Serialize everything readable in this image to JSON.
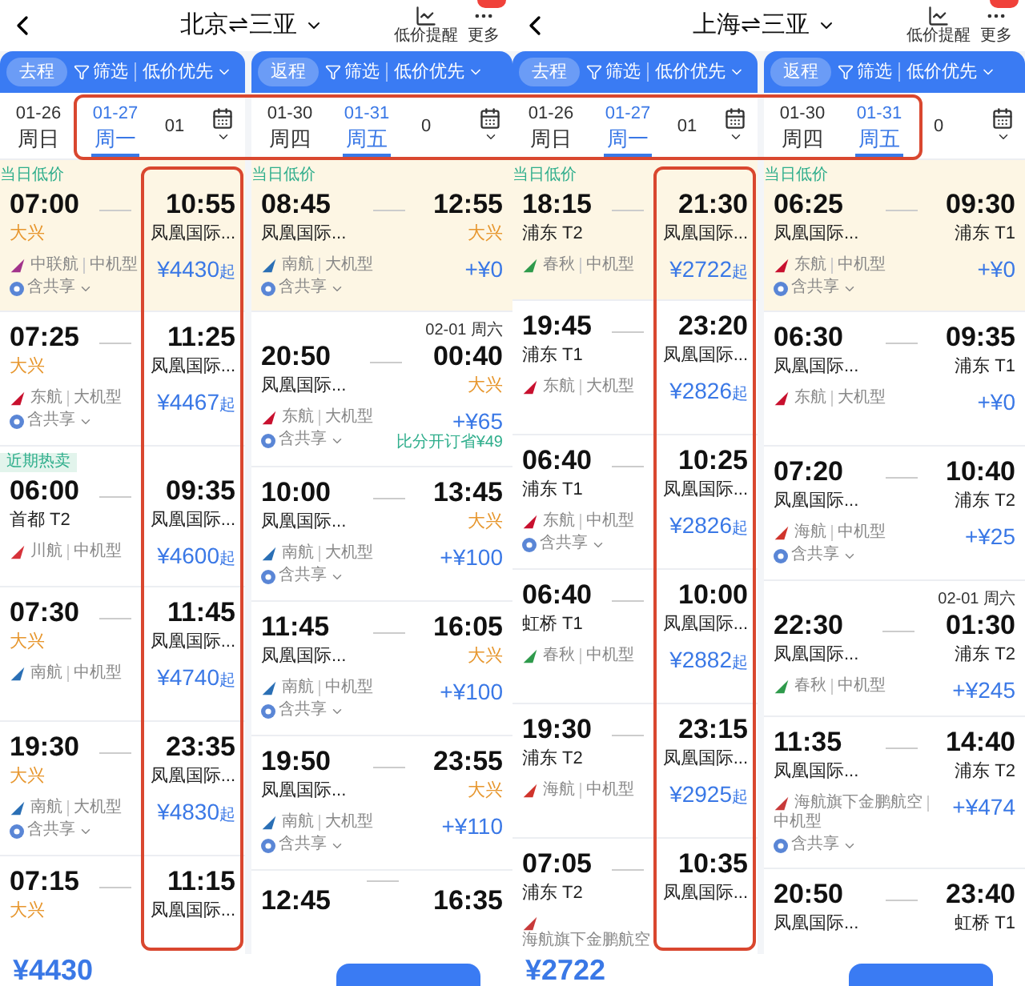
{
  "date_frame": true,
  "screens": [
    {
      "title": "北京⇌三亚",
      "alert_label": "低价提醒",
      "more_label": "更多",
      "total_price": "¥4430",
      "panels": [
        {
          "trip": "去程",
          "filter": "筛选",
          "sort": "低价优先",
          "price_frame": true,
          "dates": [
            {
              "date": "01-26",
              "weekday": "周日",
              "selected": false
            },
            {
              "date": "01-27",
              "weekday": "周一",
              "selected": true
            },
            {
              "date": "01",
              "selected": false
            }
          ],
          "flights": [
            {
              "tag": {
                "text": "当日低价",
                "kind": "plain"
              },
              "highlighted": true,
              "depart": {
                "time": "07:00",
                "airport": "大兴",
                "alert": true
              },
              "arrive": {
                "time": "10:55",
                "airport": "凤凰国际...",
                "alert": false
              },
              "airline": {
                "name": "中联航",
                "color": "#a2338b",
                "aircraft": "中机型"
              },
              "share_label": "含共享",
              "price": "¥4430",
              "price_suffix": "起"
            },
            {
              "highlighted": false,
              "depart": {
                "time": "07:25",
                "airport": "大兴",
                "alert": true
              },
              "arrive": {
                "time": "11:25",
                "airport": "凤凰国际...",
                "alert": false
              },
              "airline": {
                "name": "东航",
                "color": "#c8102e",
                "aircraft": "大机型"
              },
              "share_label": "含共享",
              "price": "¥4467",
              "price_suffix": "起"
            },
            {
              "tag": {
                "text": "近期热卖",
                "kind": "badge"
              },
              "highlighted": false,
              "depart": {
                "time": "06:00",
                "airport": "首都 T2",
                "alert": false
              },
              "arrive": {
                "time": "09:35",
                "airport": "凤凰国际...",
                "alert": false
              },
              "airline": {
                "name": "川航",
                "color": "#d6323a",
                "aircraft": "中机型"
              },
              "price": "¥4600",
              "price_suffix": "起"
            },
            {
              "highlighted": false,
              "depart": {
                "time": "07:30",
                "airport": "大兴",
                "alert": true
              },
              "arrive": {
                "time": "11:45",
                "airport": "凤凰国际...",
                "alert": false
              },
              "airline": {
                "name": "南航",
                "color": "#2a6fb5",
                "aircraft": "中机型"
              },
              "price": "¥4740",
              "price_suffix": "起"
            },
            {
              "highlighted": false,
              "depart": {
                "time": "19:30",
                "airport": "大兴",
                "alert": true
              },
              "arrive": {
                "time": "23:35",
                "airport": "凤凰国际...",
                "alert": false
              },
              "airline": {
                "name": "南航",
                "color": "#2a6fb5",
                "aircraft": "大机型"
              },
              "share_label": "含共享",
              "price": "¥4830",
              "price_suffix": "起"
            },
            {
              "highlighted": false,
              "depart": {
                "time": "07:15",
                "airport": "大兴",
                "alert": true
              },
              "arrive": {
                "time": "11:15",
                "airport": "凤凰国际...",
                "alert": false
              }
            }
          ]
        },
        {
          "trip": "返程",
          "filter": "筛选",
          "sort": "低价优先",
          "dates": [
            {
              "date": "01-30",
              "weekday": "周四",
              "selected": false
            },
            {
              "date": "01-31",
              "weekday": "周五",
              "selected": true
            },
            {
              "date": "0",
              "selected": false
            }
          ],
          "flights": [
            {
              "tag": {
                "text": "当日低价",
                "kind": "plain"
              },
              "highlighted": true,
              "depart": {
                "time": "08:45",
                "airport": "凤凰国际...",
                "alert": false
              },
              "arrive": {
                "time": "12:55",
                "airport": "大兴",
                "alert": true
              },
              "airline": {
                "name": "南航",
                "color": "#2a6fb5",
                "aircraft": "大机型"
              },
              "share_label": "含共享",
              "price": "+¥0"
            },
            {
              "highlighted": false,
              "depart": {
                "time": "20:50",
                "airport": "凤凰国际...",
                "alert": false
              },
              "arrive": {
                "date_note": "02-01 周六",
                "time": "00:40",
                "airport": "大兴",
                "alert": true
              },
              "airline": {
                "name": "东航",
                "color": "#c8102e",
                "aircraft": "大机型"
              },
              "share_label": "含共享",
              "price": "+¥65",
              "saving": "比分开订省¥49"
            },
            {
              "highlighted": false,
              "depart": {
                "time": "10:00",
                "airport": "凤凰国际...",
                "alert": false
              },
              "arrive": {
                "time": "13:45",
                "airport": "大兴",
                "alert": true
              },
              "airline": {
                "name": "南航",
                "color": "#2a6fb5",
                "aircraft": "大机型"
              },
              "share_label": "含共享",
              "price": "+¥100"
            },
            {
              "highlighted": false,
              "depart": {
                "time": "11:45",
                "airport": "凤凰国际...",
                "alert": false
              },
              "arrive": {
                "time": "16:05",
                "airport": "大兴",
                "alert": true
              },
              "airline": {
                "name": "南航",
                "color": "#2a6fb5",
                "aircraft": "中机型"
              },
              "share_label": "含共享",
              "price": "+¥100"
            },
            {
              "highlighted": false,
              "depart": {
                "time": "19:50",
                "airport": "凤凰国际...",
                "alert": false
              },
              "arrive": {
                "time": "23:55",
                "airport": "大兴",
                "alert": true
              },
              "airline": {
                "name": "南航",
                "color": "#2a6fb5",
                "aircraft": "大机型"
              },
              "share_label": "含共享",
              "price": "+¥110"
            },
            {
              "highlighted": false,
              "depart": {
                "time": "12:45"
              },
              "arrive": {
                "time": "16:35"
              }
            }
          ]
        }
      ]
    },
    {
      "title": "上海⇌三亚",
      "alert_label": "低价提醒",
      "more_label": "更多",
      "total_price": "¥2722",
      "panels": [
        {
          "trip": "去程",
          "filter": "筛选",
          "sort": "低价优先",
          "price_frame": true,
          "dates": [
            {
              "date": "01-26",
              "weekday": "周日",
              "selected": false
            },
            {
              "date": "01-27",
              "weekday": "周一",
              "selected": true
            },
            {
              "date": "01",
              "selected": false
            }
          ],
          "flights": [
            {
              "tag": {
                "text": "当日低价",
                "kind": "plain"
              },
              "highlighted": true,
              "depart": {
                "time": "18:15",
                "airport": "浦东 T2",
                "alert": false
              },
              "arrive": {
                "time": "21:30",
                "airport": "凤凰国际...",
                "alert": false
              },
              "airline": {
                "name": "春秋",
                "color": "#2e9a4b",
                "aircraft": "中机型"
              },
              "price": "¥2722",
              "price_suffix": "起"
            },
            {
              "highlighted": false,
              "depart": {
                "time": "19:45",
                "airport": "浦东 T1",
                "alert": false
              },
              "arrive": {
                "time": "23:20",
                "airport": "凤凰国际...",
                "alert": false
              },
              "airline": {
                "name": "东航",
                "color": "#c8102e",
                "aircraft": "大机型"
              },
              "price": "¥2826",
              "price_suffix": "起"
            },
            {
              "highlighted": false,
              "depart": {
                "time": "06:40",
                "airport": "浦东 T1",
                "alert": false
              },
              "arrive": {
                "time": "10:25",
                "airport": "凤凰国际...",
                "alert": false
              },
              "airline": {
                "name": "东航",
                "color": "#c8102e",
                "aircraft": "中机型"
              },
              "share_label": "含共享",
              "price": "¥2826",
              "price_suffix": "起"
            },
            {
              "highlighted": false,
              "depart": {
                "time": "06:40",
                "airport": "虹桥 T1",
                "alert": false
              },
              "arrive": {
                "time": "10:00",
                "airport": "凤凰国际...",
                "alert": false
              },
              "airline": {
                "name": "春秋",
                "color": "#2e9a4b",
                "aircraft": "中机型"
              },
              "price": "¥2882",
              "price_suffix": "起"
            },
            {
              "highlighted": false,
              "depart": {
                "time": "19:30",
                "airport": "浦东 T2",
                "alert": false
              },
              "arrive": {
                "time": "23:15",
                "airport": "凤凰国际...",
                "alert": false
              },
              "airline": {
                "name": "海航",
                "color": "#d0342c",
                "aircraft": "中机型"
              },
              "price": "¥2925",
              "price_suffix": "起"
            },
            {
              "highlighted": false,
              "depart": {
                "time": "07:05",
                "airport": "浦东 T2",
                "alert": false
              },
              "arrive": {
                "time": "10:35",
                "airport": "凤凰国际...",
                "alert": false
              },
              "airline": {
                "name": "海航旗下金鹏航空",
                "color": "#c83a3a"
              }
            }
          ]
        },
        {
          "trip": "返程",
          "filter": "筛选",
          "sort": "低价优先",
          "dates": [
            {
              "date": "01-30",
              "weekday": "周四",
              "selected": false
            },
            {
              "date": "01-31",
              "weekday": "周五",
              "selected": true
            },
            {
              "date": "0",
              "selected": false
            }
          ],
          "flights": [
            {
              "tag": {
                "text": "当日低价",
                "kind": "plain"
              },
              "highlighted": true,
              "depart": {
                "time": "06:25",
                "airport": "凤凰国际...",
                "alert": false
              },
              "arrive": {
                "time": "09:30",
                "airport": "浦东 T1",
                "alert": false
              },
              "airline": {
                "name": "东航",
                "color": "#c8102e",
                "aircraft": "中机型"
              },
              "share_label": "含共享",
              "price": "+¥0"
            },
            {
              "highlighted": false,
              "depart": {
                "time": "06:30",
                "airport": "凤凰国际...",
                "alert": false
              },
              "arrive": {
                "time": "09:35",
                "airport": "浦东 T1",
                "alert": false
              },
              "airline": {
                "name": "东航",
                "color": "#c8102e",
                "aircraft": "大机型"
              },
              "price": "+¥0"
            },
            {
              "highlighted": false,
              "depart": {
                "time": "07:20",
                "airport": "凤凰国际...",
                "alert": false
              },
              "arrive": {
                "time": "10:40",
                "airport": "浦东 T2",
                "alert": false
              },
              "airline": {
                "name": "海航",
                "color": "#d0342c",
                "aircraft": "中机型"
              },
              "share_label": "含共享",
              "price": "+¥25"
            },
            {
              "highlighted": false,
              "depart": {
                "time": "22:30",
                "airport": "凤凰国际...",
                "alert": false
              },
              "arrive": {
                "date_note": "02-01 周六",
                "time": "01:30",
                "airport": "浦东 T2",
                "alert": false
              },
              "airline": {
                "name": "春秋",
                "color": "#2e9a4b",
                "aircraft": "中机型"
              },
              "price": "+¥245"
            },
            {
              "highlighted": false,
              "depart": {
                "time": "11:35",
                "airport": "凤凰国际...",
                "alert": false
              },
              "arrive": {
                "time": "14:40",
                "airport": "浦东 T2",
                "alert": false
              },
              "airline": {
                "name": "海航旗下金鹏航空",
                "color": "#c83a3a",
                "aircraft": "中机型"
              },
              "share_label": "含共享",
              "price": "+¥474"
            },
            {
              "highlighted": false,
              "depart": {
                "time": "20:50",
                "airport": "凤凰国际...",
                "alert": false
              },
              "arrive": {
                "time": "23:40",
                "airport": "虹桥 T1",
                "alert": false
              }
            }
          ]
        }
      ]
    }
  ]
}
